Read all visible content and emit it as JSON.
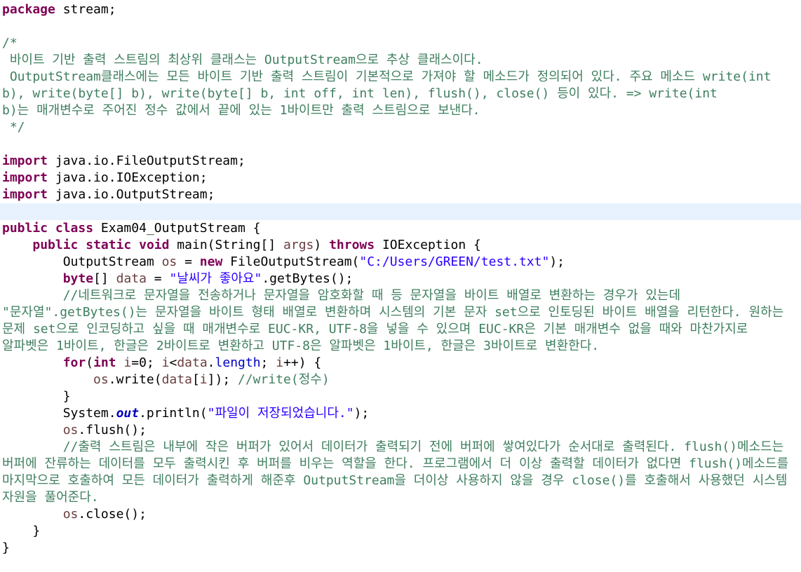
{
  "editor": {
    "lines": [
      [
        {
          "t": "package",
          "c": "kw"
        },
        {
          "t": " stream;"
        }
      ],
      [],
      [
        {
          "t": "/*",
          "c": "cm"
        }
      ],
      [
        {
          "t": " 바이트 기반 출력 스트림의 최상위 클래스는 OutputStream으로 추상 클래스이다.",
          "c": "cm"
        }
      ],
      [
        {
          "t": " OutputStream클래스에는 모든 바이트 기반 출력 스트림이 기본적으로 가져야 할 메소드가 정의되어 있다. 주요 메소드 write(int",
          "c": "cm"
        }
      ],
      [
        {
          "t": "b), write(byte[] b), write(byte[] b, int off, int len), flush(), close() 등이 있다. => write(int",
          "c": "cm"
        }
      ],
      [
        {
          "t": "b)는 매개변수로 주어진 정수 값에서 끝에 있는 1바이트만 출력 스트림으로 보낸다.",
          "c": "cm"
        }
      ],
      [
        {
          "t": " */",
          "c": "cm"
        }
      ],
      [],
      [
        {
          "t": "import",
          "c": "kw"
        },
        {
          "t": " java.io.FileOutputStream;"
        }
      ],
      [
        {
          "t": "import",
          "c": "kw"
        },
        {
          "t": " java.io.IOException;"
        }
      ],
      [
        {
          "t": "import",
          "c": "kw"
        },
        {
          "t": " java.io.OutputStream;"
        }
      ],
      [],
      [
        {
          "t": "public",
          "c": "kw"
        },
        {
          "t": " "
        },
        {
          "t": "class",
          "c": "kw"
        },
        {
          "t": " Exam04_OutputStream {"
        }
      ],
      [
        {
          "t": "    "
        },
        {
          "t": "public",
          "c": "kw"
        },
        {
          "t": " "
        },
        {
          "t": "static",
          "c": "kw"
        },
        {
          "t": " "
        },
        {
          "t": "void",
          "c": "kw"
        },
        {
          "t": " main(String[] "
        },
        {
          "t": "args",
          "c": "var"
        },
        {
          "t": ") "
        },
        {
          "t": "throws",
          "c": "kw"
        },
        {
          "t": " IOException {"
        }
      ],
      [
        {
          "t": "        OutputStream "
        },
        {
          "t": "os",
          "c": "var"
        },
        {
          "t": " = "
        },
        {
          "t": "new",
          "c": "kw"
        },
        {
          "t": " FileOutputStream("
        },
        {
          "t": "\"C:/Users/GREEN/test.txt\"",
          "c": "str"
        },
        {
          "t": ");"
        }
      ],
      [
        {
          "t": "        "
        },
        {
          "t": "byte",
          "c": "kw"
        },
        {
          "t": "[] "
        },
        {
          "t": "data",
          "c": "var"
        },
        {
          "t": " = "
        },
        {
          "t": "\"날씨가 좋아요\"",
          "c": "str"
        },
        {
          "t": ".getBytes();"
        }
      ],
      [
        {
          "t": "        //네트워크로 문자열을 전송하거나 문자열을 암호화할 때 등 문자열을 바이트 배열로 변환하는 경우가 있는데",
          "c": "cm"
        }
      ],
      [
        {
          "t": "\"문자열\".getBytes()는 문자열을 바이트 형태 배열로 변환하며 시스템의 기본 문자 set으로 인토딩된 바이트 배열을 리턴한다. 원하는",
          "c": "cm"
        }
      ],
      [
        {
          "t": "문제 set으로 인코딩하고 싶을 때 매개변수로 EUC-KR, UTF-8을 넣을 수 있으며 EUC-KR은 기본 매개변수 없을 때와 마찬가지로",
          "c": "cm"
        }
      ],
      [
        {
          "t": "알파벳은 1바이트, 한글은 2바이트로 변환하고 UTF-8은 알파벳은 1바이트, 한글은 3바이트로 변환한다.",
          "c": "cm"
        }
      ],
      [
        {
          "t": "        "
        },
        {
          "t": "for",
          "c": "kw"
        },
        {
          "t": "("
        },
        {
          "t": "int",
          "c": "kw"
        },
        {
          "t": " "
        },
        {
          "t": "i",
          "c": "var"
        },
        {
          "t": "=0; "
        },
        {
          "t": "i",
          "c": "var"
        },
        {
          "t": "<"
        },
        {
          "t": "data",
          "c": "var"
        },
        {
          "t": "."
        },
        {
          "t": "length",
          "c": "fld"
        },
        {
          "t": "; "
        },
        {
          "t": "i",
          "c": "var"
        },
        {
          "t": "++) {"
        }
      ],
      [
        {
          "t": "            "
        },
        {
          "t": "os",
          "c": "var"
        },
        {
          "t": ".write("
        },
        {
          "t": "data",
          "c": "var"
        },
        {
          "t": "["
        },
        {
          "t": "i",
          "c": "var"
        },
        {
          "t": "]); "
        },
        {
          "t": "//write(정수)",
          "c": "cm"
        }
      ],
      [
        {
          "t": "        }"
        }
      ],
      [
        {
          "t": "        System."
        },
        {
          "t": "out",
          "c": "sfld"
        },
        {
          "t": ".println("
        },
        {
          "t": "\"파일이 저장되었습니다.\"",
          "c": "str"
        },
        {
          "t": ");"
        }
      ],
      [
        {
          "t": "        "
        },
        {
          "t": "os",
          "c": "var"
        },
        {
          "t": ".flush();"
        }
      ],
      [
        {
          "t": "        //출력 스트림은 내부에 작은 버퍼가 있어서 데이터가 출력되기 전에 버퍼에 쌓여있다가 순서대로 출력된다. flush()메소드는",
          "c": "cm"
        }
      ],
      [
        {
          "t": "버퍼에 잔류하는 데이터를 모두 출력시킨 후 버퍼를 비우는 역할을 한다. 프로그램에서 더 이상 출력할 데이터가 없다면 flush()메소드를",
          "c": "cm"
        }
      ],
      [
        {
          "t": "마지막으로 호출하여 모든 데이터가 출력하게 해준후 OutputStream을 더이상 사용하지 않을 경우 close()를 호출해서 사용했던 시스템",
          "c": "cm"
        }
      ],
      [
        {
          "t": "자원을 풀어준다.",
          "c": "cm"
        }
      ],
      [
        {
          "t": "        "
        },
        {
          "t": "os",
          "c": "var"
        },
        {
          "t": ".close();"
        }
      ],
      [
        {
          "t": "    }"
        }
      ],
      [
        {
          "t": "}"
        }
      ]
    ],
    "current_line_index": 12,
    "colors": {
      "background": "#ffffff",
      "keyword": "#7f0055",
      "comment": "#3f7f5f",
      "string": "#2a00ff",
      "field": "#0000c0",
      "variable": "#6a3e3e",
      "current_line": "#e8f2fe"
    }
  }
}
